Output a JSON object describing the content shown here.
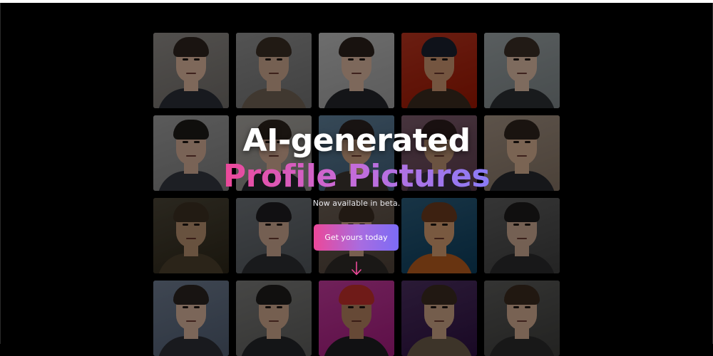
{
  "hero": {
    "title_line1": "AI-generated",
    "title_line2": "Profile Pictures",
    "subtitle": "Now available in beta.",
    "cta_label": "Get yours today",
    "scroll_icon": "arrow-down-icon"
  },
  "colors": {
    "background": "#000000",
    "gradient_start": "#ec4899",
    "gradient_end": "#8b7cf6"
  },
  "gallery": {
    "rows": 4,
    "columns": 5,
    "tiles": [
      {
        "bg": "#8e8a86",
        "skin": "#d9b49b",
        "hair": "#2e241e",
        "shirt": "#2a2d36"
      },
      {
        "bg": "#8f8f8f",
        "skin": "#caa58d",
        "hair": "#3a2d24",
        "shirt": "#6e6153"
      },
      {
        "bg": "#bcbcbc",
        "skin": "#d7b39d",
        "hair": "#2a201a",
        "shirt": "#23252a"
      },
      {
        "bg": "#b8341f",
        "skin": "#c8936f",
        "hair": "#1a1f2e",
        "shirt": "#3a2a1e"
      },
      {
        "bg": "#9aa2a4",
        "skin": "#dab8a2",
        "hair": "#3a2e25",
        "shirt": "#2c2f33"
      },
      {
        "bg": "#9c9c9c",
        "skin": "#d0ab95",
        "hair": "#1d1a18",
        "shirt": "#33363e"
      },
      {
        "bg": "#a6a39e",
        "skin": "#cfa891",
        "hair": "#2c241d",
        "shirt": "#24262b"
      },
      {
        "bg": "#5e7d96",
        "skin": "#c99d7f",
        "hair": "#2a2220",
        "shirt": "#3b3430"
      },
      {
        "bg": "#7a5a6a",
        "skin": "#b99070",
        "hair": "#2b1d1d",
        "shirt": "#3a3040"
      },
      {
        "bg": "#a08f80",
        "skin": "#d3ac90",
        "hair": "#2e241c",
        "shirt": "#26282d"
      },
      {
        "bg": "#4a4436",
        "skin": "#b48d6d",
        "hair": "#3b2f22",
        "shirt": "#4a3e2b"
      },
      {
        "bg": "#6e7378",
        "skin": "#c9a48d",
        "hair": "#1e1d1f",
        "shirt": "#2b2d31"
      },
      {
        "bg": "#6b5e54",
        "skin": "#cea488",
        "hair": "#3a2c22",
        "shirt": "#2d2a27"
      },
      {
        "bg": "#2a5a78",
        "skin": "#d09a6e",
        "hair": "#6a3a1e",
        "shirt": "#b45a1e"
      },
      {
        "bg": "#5c5c5c",
        "skin": "#c9a68f",
        "hair": "#1d1b1a",
        "shirt": "#2a2a2c"
      },
      {
        "bg": "#6d7a8e",
        "skin": "#d5b09a",
        "hair": "#2a2320",
        "shirt": "#2c2e35"
      },
      {
        "bg": "#7a7a78",
        "skin": "#caa48b",
        "hair": "#1e1c1b",
        "shirt": "#242528"
      },
      {
        "bg": "#c0399a",
        "skin": "#b07e5e",
        "hair": "#c0302a",
        "shirt": "#1e1e22"
      },
      {
        "bg": "#4a2e5e",
        "skin": "#c9a083",
        "hair": "#3a2a20",
        "shirt": "#6a5a48"
      },
      {
        "bg": "#5a5a58",
        "skin": "#cfa98f",
        "hair": "#3a2a1e",
        "shirt": "#2a2a2a"
      }
    ]
  }
}
